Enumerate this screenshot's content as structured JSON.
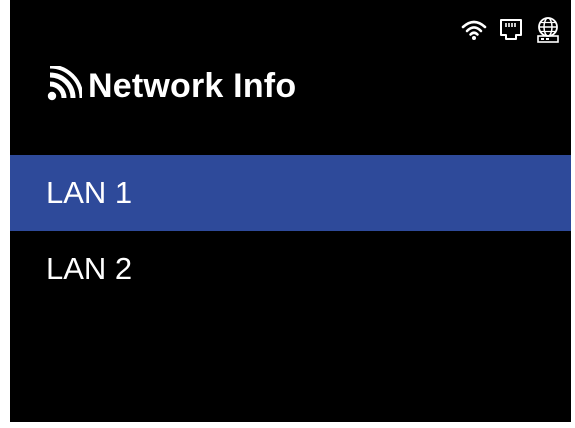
{
  "status_icons": [
    "wifi-icon",
    "ethernet-port-icon",
    "internet-globe-icon"
  ],
  "header": {
    "icon": "network-signal-icon",
    "title": "Network Info"
  },
  "menu": {
    "items": [
      {
        "label": "LAN 1",
        "selected": true
      },
      {
        "label": "LAN 2",
        "selected": false
      }
    ]
  },
  "colors": {
    "background": "#000000",
    "text": "#ffffff",
    "selected_bg": "#2e4a9a"
  }
}
